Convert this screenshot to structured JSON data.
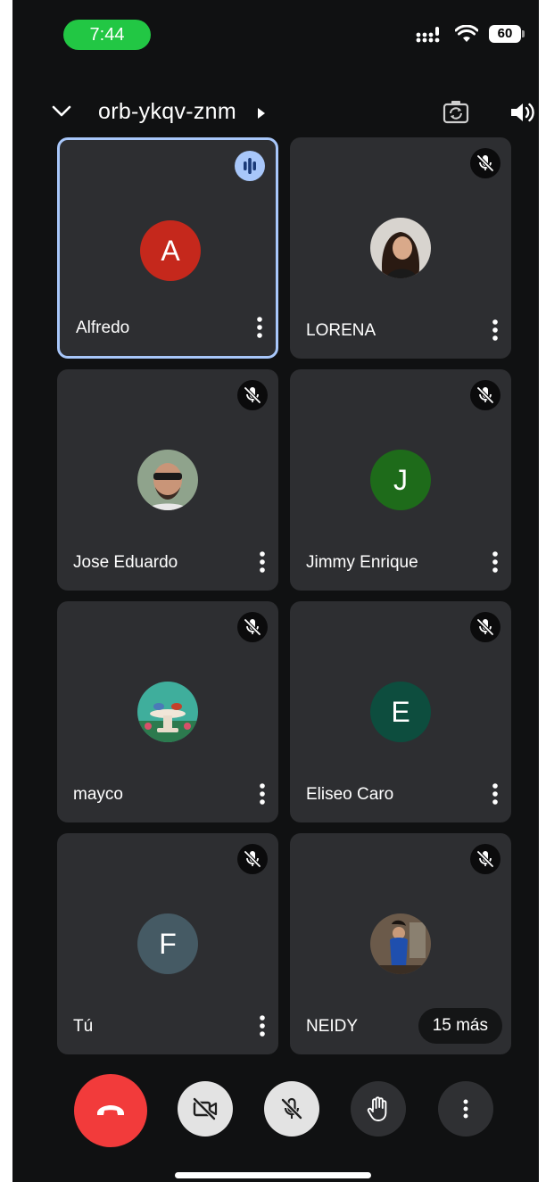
{
  "status_bar": {
    "time": "7:44",
    "battery": "60",
    "time_pill_color": "#22c744"
  },
  "header": {
    "meeting_code": "orb-ykqv-znm",
    "icons": [
      "chevron-down-icon",
      "chevron-right-icon",
      "camera-switch-icon",
      "speaker-icon"
    ]
  },
  "participants": [
    {
      "name": "Alfredo",
      "initial": "A",
      "avatar_color": "#c5281c",
      "state": "speaking"
    },
    {
      "name": "LORENA",
      "initial": "",
      "avatar_color": "#8a6b5c",
      "state": "muted",
      "avatar_type": "photo"
    },
    {
      "name": "Jose Eduardo",
      "initial": "",
      "avatar_color": "#7a8a7c",
      "state": "muted",
      "avatar_type": "photo"
    },
    {
      "name": "Jimmy Enrique",
      "initial": "J",
      "avatar_color": "#1e6b1a",
      "state": "muted"
    },
    {
      "name": "mayco",
      "initial": "",
      "avatar_color": "#2d9a8a",
      "state": "muted",
      "avatar_type": "illustration"
    },
    {
      "name": "Eliseo Caro",
      "initial": "E",
      "avatar_color": "#0d4d3e",
      "state": "muted"
    },
    {
      "name": "Tú",
      "initial": "F",
      "avatar_color": "#455a64",
      "state": "muted"
    },
    {
      "name": "NEIDY",
      "initial": "",
      "avatar_color": "#5a4a3e",
      "state": "muted",
      "avatar_type": "photo"
    }
  ],
  "more_participants": "15 más",
  "controls": {
    "buttons": [
      "end-call-button",
      "camera-off-button",
      "mic-off-button",
      "raise-hand-button",
      "more-options-button"
    ],
    "end_call_color": "#f23b3b"
  }
}
